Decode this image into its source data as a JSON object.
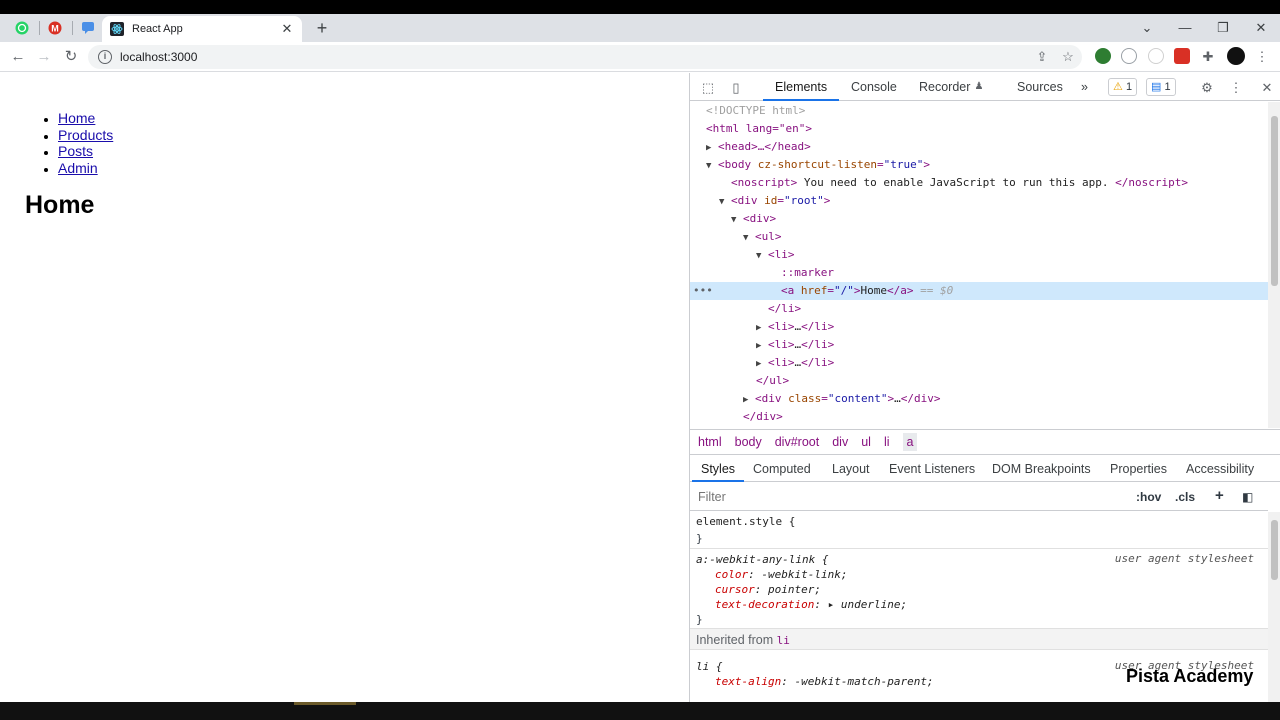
{
  "browser": {
    "tab_title": "React App",
    "new_tab_symbol": "+",
    "url": "localhost:3000",
    "window_controls": [
      "⌄",
      "—",
      "❐",
      "✕"
    ]
  },
  "page": {
    "nav": [
      "Home",
      "Products",
      "Posts",
      "Admin"
    ],
    "heading": "Home"
  },
  "devtools": {
    "tabs": [
      "Elements",
      "Console",
      "Recorder",
      "Sources"
    ],
    "more_tabs": "»",
    "warning_count": "1",
    "message_count": "1",
    "dom": {
      "doctype": "<!DOCTYPE html>",
      "html_open": "<html lang=\"en\">",
      "head": "<head>…</head>",
      "body_attr_name": "cz-shortcut-listen",
      "body_attr_value": "\"true\"",
      "noscript_text": "You need to enable JavaScript to run this app.",
      "root_id": "\"root\"",
      "marker": "::marker",
      "selected_href": "\"/\"",
      "selected_text": "Home",
      "selected_suffix": "== $0",
      "collapsed_li": "…",
      "content_class": "\"content\""
    },
    "breadcrumbs": [
      "html",
      "body",
      "div#root",
      "div",
      "ul",
      "li",
      "a"
    ],
    "subtabs": [
      "Styles",
      "Computed",
      "Layout",
      "Event Listeners",
      "DOM Breakpoints",
      "Properties",
      "Accessibility"
    ],
    "filter_placeholder": "Filter",
    "filter_tools": [
      ":hov",
      ".cls",
      "+"
    ],
    "styles": {
      "element_style": "element.style {",
      "close": "}",
      "rule1_selector": "a:-webkit-any-link {",
      "rule1_source": "user agent stylesheet",
      "rule1_props": [
        {
          "name": "color",
          "value": "-webkit-link;"
        },
        {
          "name": "cursor",
          "value": "pointer;"
        },
        {
          "name": "text-decoration",
          "value": "▸ underline;"
        }
      ],
      "inherited_label": "Inherited from",
      "inherited_tag": "li",
      "rule2_selector": "li {",
      "rule2_source": "user agent stylesheet",
      "rule2_props": [
        {
          "name": "text-align",
          "value": "-webkit-match-parent;"
        }
      ]
    }
  },
  "watermark": "Pista Academy",
  "colors": {
    "tag": "#881280",
    "attr_name": "#994500",
    "attr_value": "#1a1aa6",
    "selection": "#cfe8fc",
    "accent": "#1a73e8"
  }
}
